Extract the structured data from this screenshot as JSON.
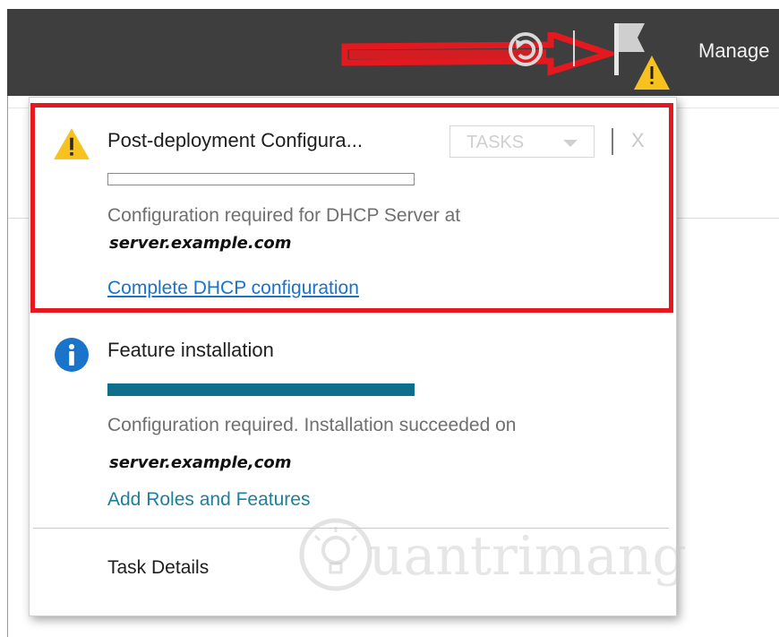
{
  "toolbar": {
    "manage_label": "Manage",
    "icons": [
      "refresh-icon",
      "notification-flag-icon",
      "warning-icon"
    ],
    "annotation_color": "#e3191f"
  },
  "notifications": [
    {
      "type": "warning",
      "icon": "warning-icon",
      "title": "Post-deployment Configura...",
      "progress": 0,
      "description": "Configuration required for DHCP Server at",
      "server": "server.example.com",
      "link": "Complete DHCP configuration",
      "tasks_label": "TASKS",
      "close_label": "X"
    },
    {
      "type": "info",
      "icon": "info-icon",
      "title": "Feature installation",
      "progress": 1.0,
      "description": "Configuration required. Installation succeeded on",
      "server": "server.example,com",
      "link": "Add Roles and Features"
    }
  ],
  "footer": {
    "task_details_label": "Task Details"
  },
  "colors": {
    "toolbar_bg": "#3e3e3e",
    "progress_fill": "#0e6f8c",
    "link_blue": "#1a73c8",
    "link_teal": "#1b7fa0",
    "warning_yellow": "#f7c21e",
    "info_blue": "#1a74c9",
    "highlight_red": "#e3191f"
  },
  "watermark": {
    "text": "uantrimang"
  }
}
